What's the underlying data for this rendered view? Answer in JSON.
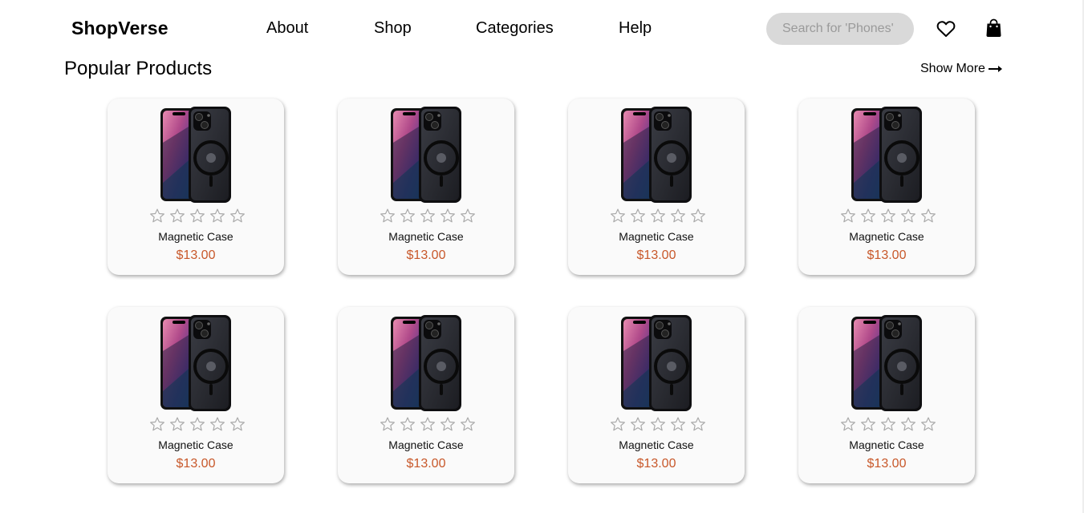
{
  "header": {
    "logo": "ShopVerse",
    "nav": [
      "About",
      "Shop",
      "Categories",
      "Help"
    ],
    "search_placeholder": "Search for 'Phones'",
    "wishlist_icon": "heart-icon",
    "cart_icon": "shopping-bag-icon"
  },
  "section": {
    "title": "Popular Products",
    "show_more": "Show More"
  },
  "products": [
    {
      "name": "Magnetic Case",
      "price": "$13.00",
      "rating": 0
    },
    {
      "name": "Magnetic Case",
      "price": "$13.00",
      "rating": 0
    },
    {
      "name": "Magnetic Case",
      "price": "$13.00",
      "rating": 0
    },
    {
      "name": "Magnetic Case",
      "price": "$13.00",
      "rating": 0
    },
    {
      "name": "Magnetic Case",
      "price": "$13.00",
      "rating": 0
    },
    {
      "name": "Magnetic Case",
      "price": "$13.00",
      "rating": 0
    },
    {
      "name": "Magnetic Case",
      "price": "$13.00",
      "rating": 0
    },
    {
      "name": "Magnetic Case",
      "price": "$13.00",
      "rating": 0
    }
  ],
  "colors": {
    "price": "#c8582a",
    "card_background": "#fafafa",
    "search_background": "#d9d9d9",
    "star_outline": "#a9a9a9"
  }
}
